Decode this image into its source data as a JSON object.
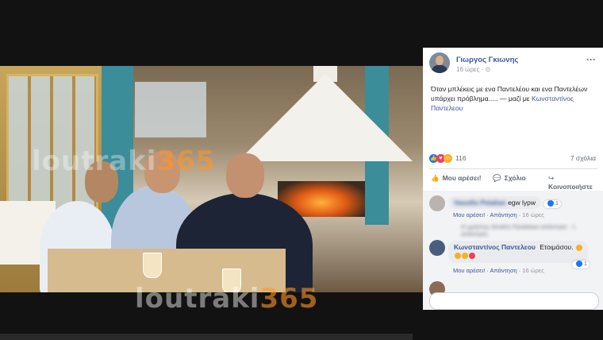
{
  "photo": {
    "watermark_main": "loutraki",
    "watermark_number": "365"
  },
  "post": {
    "author": "Γιωργος Γκιωνης",
    "meta": "16 ώρες · ⊙",
    "menu": "···",
    "text_main": "Όταν μπλέκεις με ενα Παντελέου και ενα Παντελέων υπάρχει πρόβλημα..... — μαζί με",
    "text_tag": "Κωνσταντίνος Παντελεου",
    "reaction_count": "116",
    "comment_count": "7 σχόλια",
    "actions": {
      "like": "Μου αρέσει!",
      "comment": "Σχόλιο",
      "share": "Κοινοποιήστε"
    }
  },
  "comments": [
    {
      "name": "Vassilis Pelalian",
      "text": "egw lypw",
      "like_label": "Μου αρέσει!",
      "reply_label": "Απάντηση",
      "time": "16 ώρες",
      "reaction_count": "1"
    },
    {
      "reply_summary": "Ο χρήστης Dimitris Pantelean απάντησε · 1 απάντηση"
    },
    {
      "name": "Κωνσταντίνος Παντελεου",
      "text": "Ετοιμάσου.",
      "like_label": "Μου αρέσει!",
      "reply_label": "Απάντηση",
      "time": "16 ώρες",
      "reaction_count": "1"
    }
  ],
  "icons": {
    "like": "thumbs-up-icon",
    "comment": "speech-bubble-icon",
    "share": "share-arrow-icon"
  },
  "colors": {
    "link": "#385898",
    "like_blue": "#1877f2",
    "love_red": "#f33e58"
  }
}
